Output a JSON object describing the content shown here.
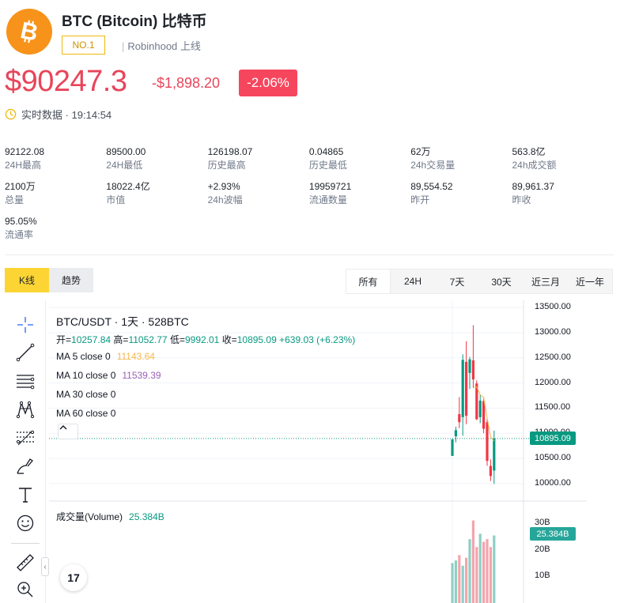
{
  "coin": {
    "title": "BTC (Bitcoin) 比特币",
    "rank": "NO.1",
    "listing": "Robinhood 上线",
    "price": "$90247.3",
    "change_abs": "-$1,898.20",
    "change_pct": "-2.06%",
    "realtime_label": "实时数据 · 19:14:54",
    "colors": {
      "down": "#f6465d",
      "brand": "#f7931a",
      "accent": "#fcd535",
      "up": "#089981"
    }
  },
  "stats": [
    {
      "value": "92122.08",
      "label": "24H最高"
    },
    {
      "value": "89500.00",
      "label": "24H最低"
    },
    {
      "value": "126198.07",
      "label": "历史最高"
    },
    {
      "value": "0.04865",
      "label": "历史最低"
    },
    {
      "value": "62万",
      "label": "24h交易量"
    },
    {
      "value": "563.8亿",
      "label": "24h成交额"
    },
    {
      "value": "2100万",
      "label": "总量"
    },
    {
      "value": "18022.4亿",
      "label": "市值"
    },
    {
      "value": "+2.93%",
      "label": "24h波幅"
    },
    {
      "value": "19959721",
      "label": "流通数量"
    },
    {
      "value": "89,554.52",
      "label": "昨开"
    },
    {
      "value": "89,961.37",
      "label": "昨收"
    },
    {
      "value": "95.05%",
      "label": "流通率"
    }
  ],
  "view_tabs": [
    {
      "label": "K线",
      "active": true
    },
    {
      "label": "趋势",
      "active": false
    }
  ],
  "range_tabs": [
    {
      "label": "所有",
      "active": true
    },
    {
      "label": "24H",
      "active": false
    },
    {
      "label": "7天",
      "active": false
    },
    {
      "label": "30天",
      "active": false
    },
    {
      "label": "近三月",
      "active": false
    },
    {
      "label": "近一年",
      "active": false
    }
  ],
  "tools": [
    "crosshair-icon",
    "trend-line-icon",
    "horizontal-lines-icon",
    "pattern-icon",
    "fib-icon",
    "brush-icon",
    "text-icon",
    "emoji-icon",
    "ruler-icon",
    "zoom-in-icon"
  ],
  "chart": {
    "symbol": "BTC/USDT · 1天 · 528BTC",
    "ohlc": {
      "open_label": "开=",
      "open": "10257.84",
      "high_label": "高=",
      "high": "11052.77",
      "low_label": "低=",
      "low": "9992.01",
      "close_label": "收=",
      "close": "10895.09",
      "change": "+639.03 (+6.23%)"
    },
    "ma": [
      {
        "label": "MA 5 close 0",
        "value": "11143.64"
      },
      {
        "label": "MA 10 close 0",
        "value": "11539.39"
      },
      {
        "label": "MA 30 close 0",
        "value": ""
      },
      {
        "label": "MA 60 close 0",
        "value": ""
      }
    ],
    "volume_label": "成交量(Volume)",
    "volume_value": "25.384B",
    "last_price_tag": "10895.09",
    "volume_tag": "25.384B",
    "tv_logo": "17"
  },
  "chart_data": {
    "type": "bar",
    "price_axis_ticks": [
      "13500.00",
      "13000.00",
      "12500.00",
      "12000.00",
      "11500.00",
      "11000.00",
      "10500.00",
      "10000.00"
    ],
    "price_ylim": [
      9840,
      13550
    ],
    "volume_axis_ticks": [
      "30B",
      "20B",
      "10B"
    ],
    "volume_ylim": [
      0,
      38
    ],
    "candles": [
      {
        "o": 10550,
        "h": 10700,
        "l": 10800,
        "c": 10880
      },
      {
        "o": 10940,
        "h": 11130,
        "l": 10820,
        "c": 11060
      },
      {
        "o": 11380,
        "h": 11720,
        "l": 11100,
        "c": 11220
      },
      {
        "o": 11320,
        "h": 12570,
        "l": 10950,
        "c": 12460
      },
      {
        "o": 12420,
        "h": 12830,
        "l": 11180,
        "c": 11350
      },
      {
        "o": 12200,
        "h": 12520,
        "l": 11880,
        "c": 12470
      },
      {
        "o": 12450,
        "h": 13150,
        "l": 11900,
        "c": 12070
      },
      {
        "o": 11990,
        "h": 12050,
        "l": 11260,
        "c": 11280
      },
      {
        "o": 11320,
        "h": 11770,
        "l": 11200,
        "c": 11650
      },
      {
        "o": 11640,
        "h": 11700,
        "l": 11000,
        "c": 11090
      },
      {
        "o": 11220,
        "h": 11280,
        "l": 10350,
        "c": 10450
      },
      {
        "o": 10350,
        "h": 10480,
        "l": 10050,
        "c": 10150
      },
      {
        "o": 10257.84,
        "h": 11052.77,
        "l": 9992.01,
        "c": 10895.09
      }
    ],
    "volumes": [
      15,
      16,
      18,
      14,
      17,
      24,
      31,
      21,
      26,
      23,
      24,
      21,
      25.384
    ]
  }
}
